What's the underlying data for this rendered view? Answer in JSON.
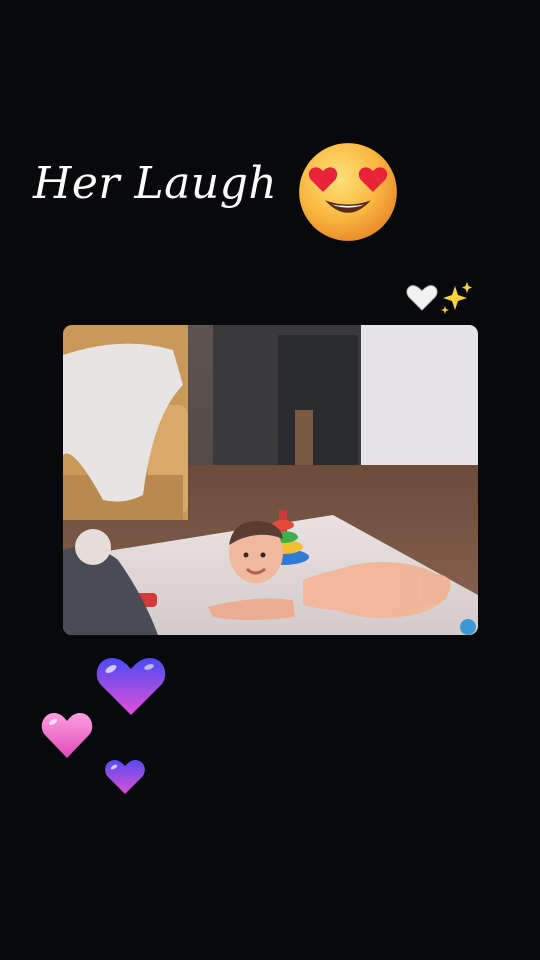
{
  "story": {
    "caption": "Her Laugh",
    "face_emoji": "smiling-face-with-heart-eyes",
    "sticker_emojis": [
      "white-heart",
      "sparkles"
    ],
    "heart_emojis": [
      "purple-gradient-heart",
      "pink-heart",
      "purple-gradient-heart-small"
    ]
  },
  "colors": {
    "background": "#08090c",
    "caption_text": "#ffffff",
    "heart_pink": "#f06fc8",
    "heart_purple_top": "#4a4cf5",
    "heart_purple_bottom": "#e34fd7"
  }
}
